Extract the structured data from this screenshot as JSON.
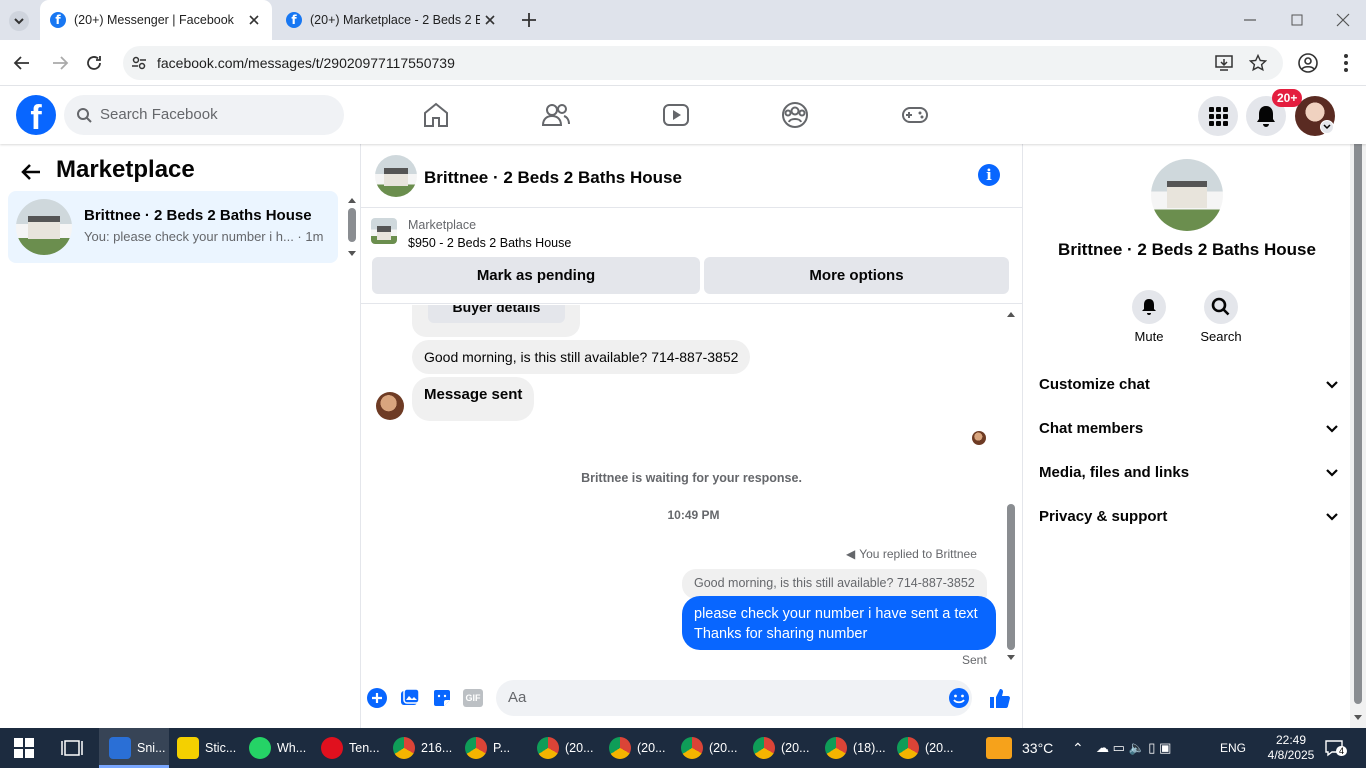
{
  "browser": {
    "tabs": [
      {
        "title": "(20+) Messenger | Facebook"
      },
      {
        "title": "(20+) Marketplace - 2 Beds 2 B"
      }
    ],
    "url": "facebook.com/messages/t/29020977117550739"
  },
  "fb": {
    "logo": "f",
    "search_placeholder": "Search Facebook",
    "notif_badge": "20+",
    "nav_icons": [
      "home-icon",
      "friends-icon",
      "watch-icon",
      "groups-icon",
      "gaming-icon"
    ]
  },
  "left": {
    "title": "Marketplace",
    "conversation": {
      "name": "Brittnee · 2 Beds 2 Baths House",
      "preview": "You: please check your number i h... · 1m"
    }
  },
  "chat": {
    "name": "Brittnee · 2 Beds 2 Baths House",
    "marketplace_label": "Marketplace",
    "listing": "$950 - 2 Beds 2 Baths House",
    "btn_pending": "Mark as pending",
    "btn_more": "More options",
    "buyer_details": "Buyer details",
    "msg1": "Good morning, is this still available? 714-887-3852",
    "msg2": "Message sent",
    "waiting": "Brittnee is waiting for your response.",
    "time": "10:49 PM",
    "replied": "You replied to Brittnee",
    "quote": "Good morning, is this still available? 714-887-3852",
    "my_line1": "please check your number i have sent a text",
    "my_line2": "Thanks for sharing number",
    "sent": "Sent",
    "composer_placeholder": "Aa"
  },
  "right": {
    "name": "Brittnee · 2 Beds 2 Baths House",
    "mute": "Mute",
    "search": "Search",
    "sections": [
      "Customize chat",
      "Chat members",
      "Media, files and links",
      "Privacy & support"
    ]
  },
  "taskbar": {
    "items": [
      "Sni...",
      "Stic...",
      "Wh...",
      "Ten...",
      "216...",
      "P...",
      "(20...",
      "(20...",
      "(20...",
      "(20...",
      "(18)...",
      "(20..."
    ],
    "weather": "33°C",
    "lang": "ENG",
    "time": "22:49",
    "date": "4/8/2025",
    "notif": "4"
  },
  "colors": {
    "brand": "#0866ff",
    "badge": "#e41e3f",
    "taskbar": "#1c2b3f"
  }
}
